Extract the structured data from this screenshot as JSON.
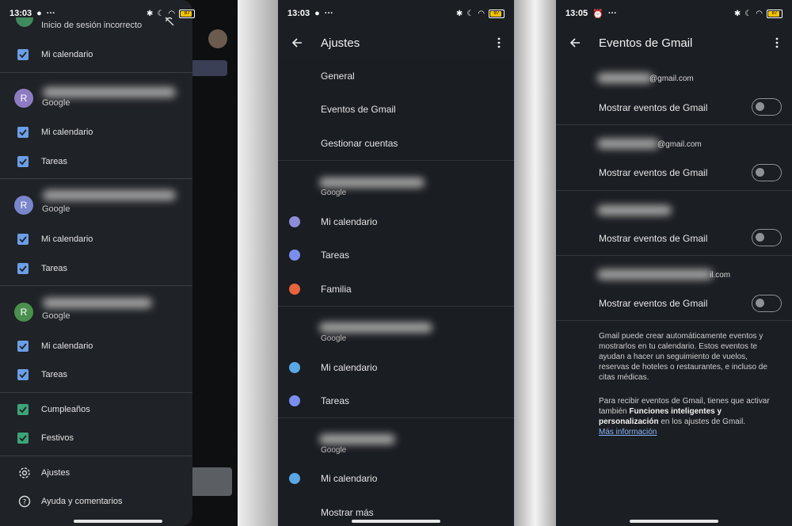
{
  "screen1": {
    "status": {
      "time": "13:03",
      "battery": "87"
    },
    "header_partial": "Inicio de sesión incorrecto",
    "first_calendar": "Mi calendario",
    "accounts": [
      {
        "initial": "R",
        "color": "#8e7cc3",
        "provider": "Google",
        "calendars": [
          "Mi calendario",
          "Tareas"
        ]
      },
      {
        "initial": "R",
        "color": "#7986cb",
        "provider": "Google",
        "calendars": [
          "Mi calendario",
          "Tareas"
        ]
      },
      {
        "initial": "R",
        "color": "#4a8f4e",
        "provider": "Google",
        "calendars": [
          "Mi calendario",
          "Tareas"
        ]
      }
    ],
    "other_calendars": [
      "Cumpleaños",
      "Festivos"
    ],
    "footer": {
      "settings": "Ajustes",
      "help": "Ayuda y comentarios"
    }
  },
  "screen2": {
    "status": {
      "time": "13:03",
      "battery": "87"
    },
    "title": "Ajustes",
    "general_items": [
      "General",
      "Eventos de Gmail",
      "Gestionar cuentas"
    ],
    "accounts": [
      {
        "provider": "Google",
        "calendars": [
          {
            "label": "Mi calendario",
            "color": "#8e8cd8"
          },
          {
            "label": "Tareas",
            "color": "#7b8ef0"
          },
          {
            "label": "Familia",
            "color": "#e8643f"
          }
        ]
      },
      {
        "provider": "Google",
        "calendars": [
          {
            "label": "Mi calendario",
            "color": "#5aa7e6"
          },
          {
            "label": "Tareas",
            "color": "#7b8ef0"
          }
        ]
      },
      {
        "provider": "Google",
        "calendars": [
          {
            "label": "Mi calendario",
            "color": "#5aa7e6"
          }
        ]
      }
    ],
    "show_more": "Mostrar más"
  },
  "screen3": {
    "status": {
      "time": "13:05",
      "battery": "87"
    },
    "title": "Eventos de Gmail",
    "accounts": [
      {
        "email_suffix": "@gmail.com",
        "toggle_label": "Mostrar eventos de Gmail",
        "enabled": false
      },
      {
        "email_suffix": "@gmail.com",
        "toggle_label": "Mostrar eventos de Gmail",
        "enabled": false
      },
      {
        "email_suffix": "",
        "toggle_label": "Mostrar eventos de Gmail",
        "enabled": false
      },
      {
        "email_suffix": "il.com",
        "toggle_label": "Mostrar eventos de Gmail",
        "enabled": false
      }
    ],
    "info1": "Gmail puede crear automáticamente eventos y mostrarlos en tu calendario. Estos eventos te ayudan a hacer un seguimiento de vuelos, reservas de hoteles o restaurantes, e incluso de citas médicas.",
    "info2_pre": "Para recibir eventos de Gmail, tienes que activar también ",
    "info2_bold": "Funciones inteligentes y personalización",
    "info2_post": " en los ajustes de Gmail.",
    "link": "Más información"
  }
}
